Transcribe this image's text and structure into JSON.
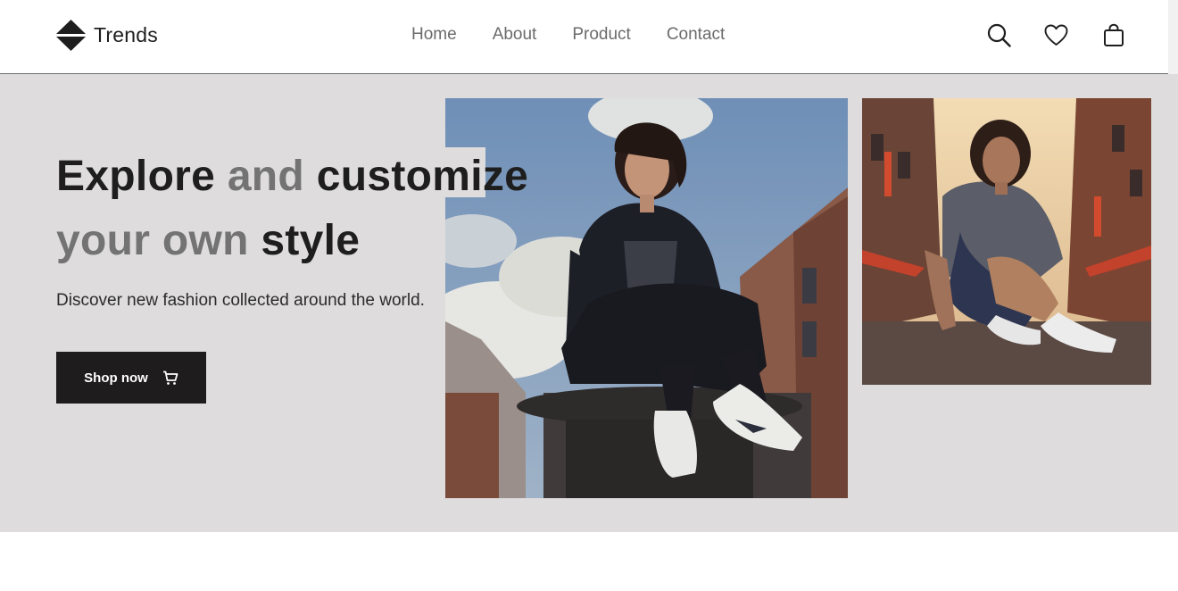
{
  "brand": {
    "name": "Trends"
  },
  "nav": {
    "items": [
      {
        "label": "Home"
      },
      {
        "label": "About"
      },
      {
        "label": "Product"
      },
      {
        "label": "Contact"
      }
    ]
  },
  "header_actions": {
    "icons": [
      "search-icon",
      "heart-icon",
      "shopping-bag-icon"
    ]
  },
  "hero": {
    "headline_parts": [
      {
        "text": "Explore",
        "tone": "dark"
      },
      {
        "text": "and",
        "tone": "muted"
      },
      {
        "text": "customize",
        "tone": "dark"
      },
      {
        "text": "your own",
        "tone": "muted"
      },
      {
        "text": "style",
        "tone": "dark"
      }
    ],
    "subtitle": "Discover new fashion collected around the world.",
    "cta_label": "Shop now",
    "cta_icon": "cart-icon"
  },
  "colors": {
    "hero_background": "#dedcdd",
    "text_dark": "#1e1e1e",
    "text_muted": "#737373",
    "nav_text": "#6b6b6b",
    "button_background": "#1e1c1c"
  }
}
